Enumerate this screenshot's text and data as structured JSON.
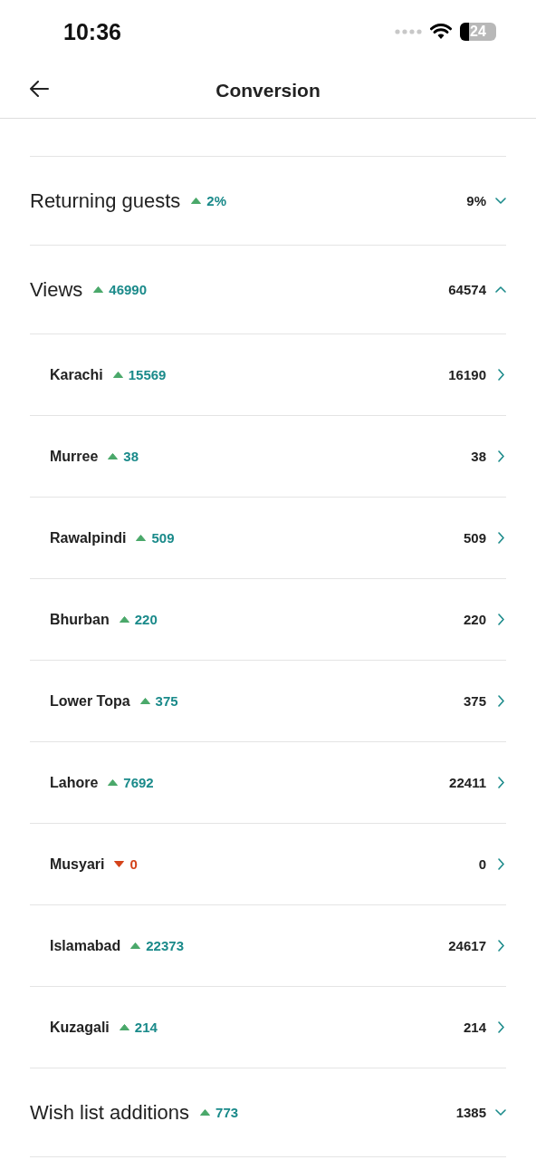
{
  "status_bar": {
    "time": "10:36",
    "battery": "24"
  },
  "header": {
    "title": "Conversion"
  },
  "metrics": [
    {
      "label": "Returning guests",
      "change": "2%",
      "increase": true,
      "total": "9%",
      "expanded": false
    },
    {
      "label": "Views",
      "change": "46990",
      "increase": true,
      "total": "64574",
      "expanded": true,
      "children": [
        {
          "label": "Karachi",
          "change": "15569",
          "increase": true,
          "total": "16190"
        },
        {
          "label": "Murree",
          "change": "38",
          "increase": true,
          "total": "38"
        },
        {
          "label": "Rawalpindi",
          "change": "509",
          "increase": true,
          "total": "509"
        },
        {
          "label": "Bhurban",
          "change": "220",
          "increase": true,
          "total": "220"
        },
        {
          "label": "Lower Topa",
          "change": "375",
          "increase": true,
          "total": "375"
        },
        {
          "label": "Lahore",
          "change": "7692",
          "increase": true,
          "total": "22411"
        },
        {
          "label": "Musyari",
          "change": "0",
          "increase": false,
          "total": "0"
        },
        {
          "label": "Islamabad",
          "change": "22373",
          "increase": true,
          "total": "24617"
        },
        {
          "label": "Kuzagali",
          "change": "214",
          "increase": true,
          "total": "214"
        }
      ]
    },
    {
      "label": "Wish list additions",
      "change": "773",
      "increase": true,
      "total": "1385",
      "expanded": false
    }
  ]
}
